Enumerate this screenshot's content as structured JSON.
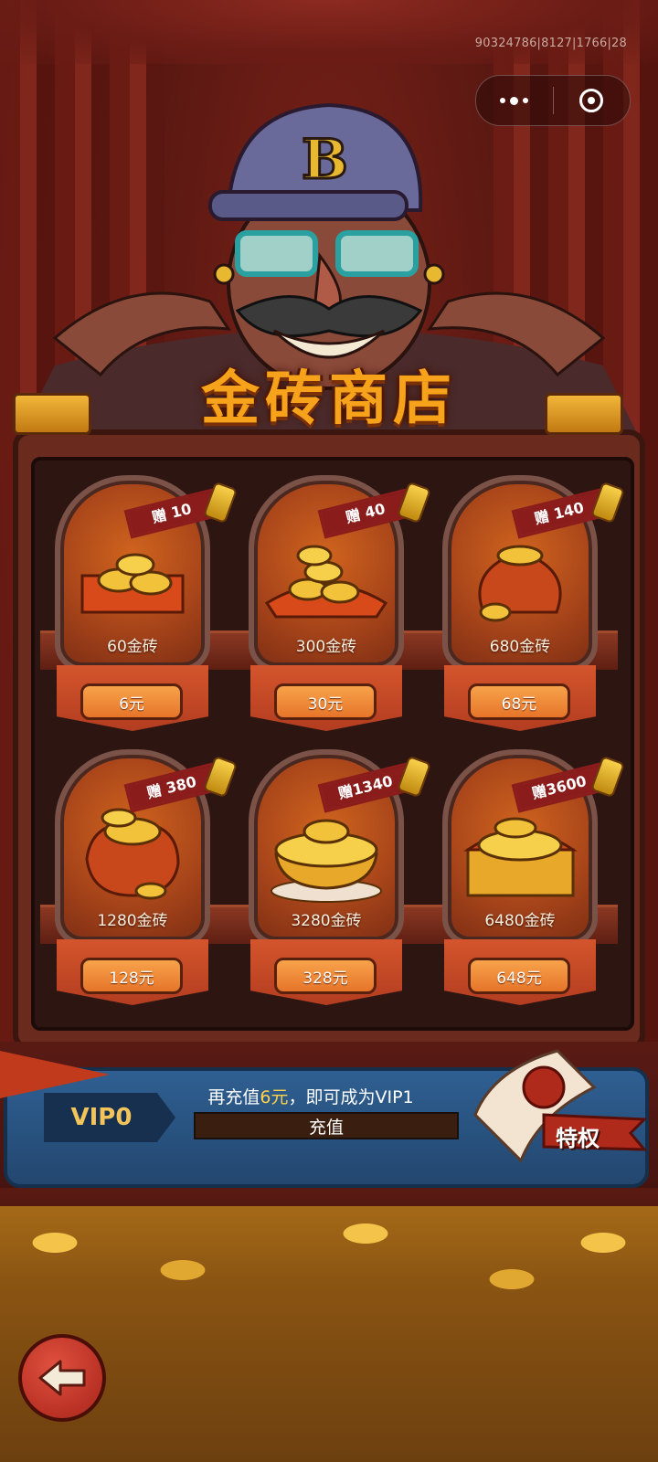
{
  "status": {
    "version_text": "90324786|8127|1766|28"
  },
  "capsule": {
    "more_icon": "more-dots-icon",
    "close_icon": "target-icon"
  },
  "title": "金砖商店",
  "items": [
    {
      "bonus": "赠 10",
      "amount": "60金砖",
      "price": "6元"
    },
    {
      "bonus": "赠 40",
      "amount": "300金砖",
      "price": "30元"
    },
    {
      "bonus": "赠 140",
      "amount": "680金砖",
      "price": "68元"
    },
    {
      "bonus": "赠 380",
      "amount": "1280金砖",
      "price": "128元"
    },
    {
      "bonus": "赠1340",
      "amount": "3280金砖",
      "price": "328元"
    },
    {
      "bonus": "赠3600",
      "amount": "6480金砖",
      "price": "648元"
    }
  ],
  "vip": {
    "level": "VIP0",
    "msg_prefix": "再充值",
    "msg_amount": "6元",
    "msg_suffix": "，即可成为VIP1",
    "recharge": "充值",
    "privilege": "特权"
  },
  "colors": {
    "gold": "#f6a21a",
    "vip_blue": "#2f5f92",
    "button_orange": "#e6742a"
  }
}
